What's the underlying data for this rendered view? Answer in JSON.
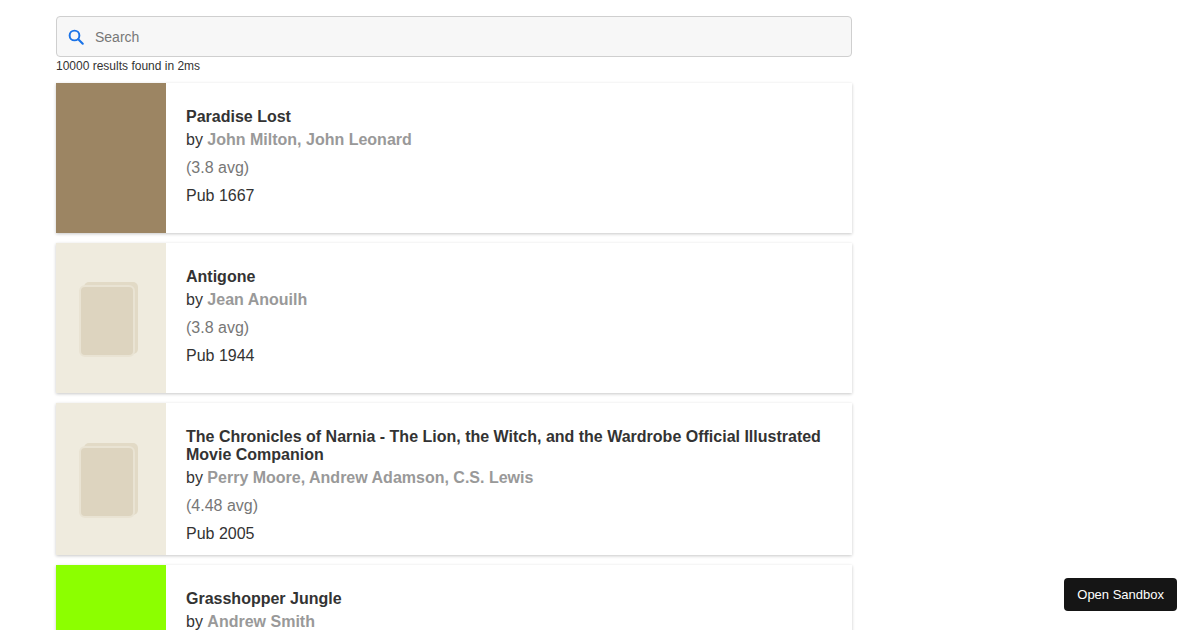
{
  "search": {
    "placeholder": "Search"
  },
  "stats": "10000 results found in 2ms",
  "by_label": "by",
  "books": [
    {
      "title": "Paradise Lost",
      "authors": "John Milton, John Leonard",
      "rating": "(3.8 avg)",
      "pub": "Pub 1667",
      "cover": {
        "kind": "photo",
        "color": "#9c8563"
      }
    },
    {
      "title": "Antigone",
      "authors": "Jean Anouilh",
      "rating": "(3.8 avg)",
      "pub": "Pub 1944",
      "cover": {
        "kind": "placeholder",
        "color": "#efebde"
      }
    },
    {
      "title": "The Chronicles of Narnia - The Lion, the Witch, and the Wardrobe Official Illustrated Movie Companion",
      "authors": "Perry Moore, Andrew Adamson, C.S. Lewis",
      "rating": "(4.48 avg)",
      "pub": "Pub 2005",
      "cover": {
        "kind": "placeholder",
        "color": "#efebde"
      }
    },
    {
      "title": "Grasshopper Jungle",
      "authors": "Andrew Smith",
      "cover": {
        "kind": "photo",
        "color": "#8cff00"
      }
    }
  ],
  "sandbox_button": "Open Sandbox"
}
